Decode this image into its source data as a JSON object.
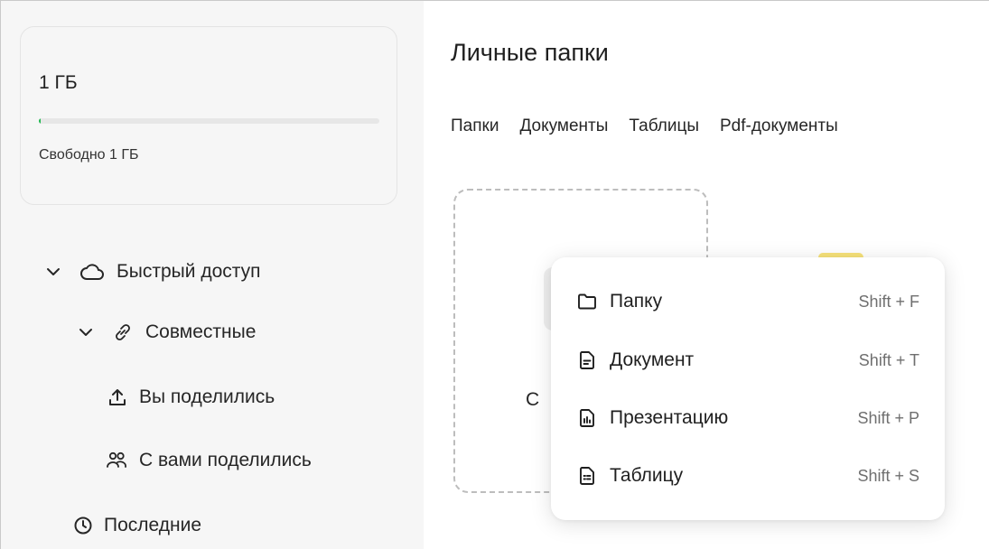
{
  "storage": {
    "total": "1 ГБ",
    "free": "Свободно 1 ГБ",
    "used_fraction": 0.003
  },
  "sidebar": {
    "items": [
      {
        "label": "Быстрый доступ",
        "icon": "cloud-icon"
      },
      {
        "label": "Совместные",
        "icon": "link-icon"
      },
      {
        "label": "Вы поделились",
        "icon": "upload-icon"
      },
      {
        "label": "С вами поделились",
        "icon": "users-icon"
      },
      {
        "label": "Последние",
        "icon": "clock-icon"
      }
    ]
  },
  "main": {
    "title": "Личные папки",
    "tabs": [
      "Папки",
      "Документы",
      "Таблицы",
      "Pdf-документы"
    ],
    "create_label_partial": "С"
  },
  "menu": {
    "items": [
      {
        "label": "Папку",
        "shortcut": "Shift + F",
        "icon": "folder-icon"
      },
      {
        "label": "Документ",
        "shortcut": "Shift + T",
        "icon": "document-icon"
      },
      {
        "label": "Презентацию",
        "shortcut": "Shift + P",
        "icon": "presentation-icon"
      },
      {
        "label": "Таблицу",
        "shortcut": "Shift + S",
        "icon": "spreadsheet-icon"
      }
    ]
  },
  "colors": {
    "accent_green": "#1db84f",
    "sidebar_bg": "#f6f6f6"
  }
}
